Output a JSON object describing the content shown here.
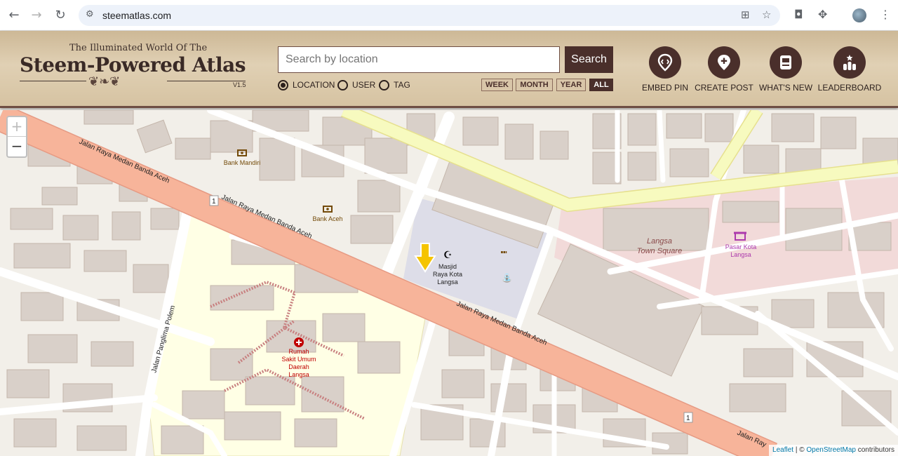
{
  "browser": {
    "url": "steematlas.com",
    "icons": [
      "back-icon",
      "forward-icon",
      "reload-icon",
      "site-info-icon",
      "translate-icon",
      "star-icon",
      "camera-icon",
      "extensions-icon",
      "profile-avatar",
      "menu-icon"
    ]
  },
  "header": {
    "subtitle": "The Illuminated World Of The",
    "title": "Steem-Powered Atlas",
    "version": "V1.5",
    "search_placeholder": "Search by location",
    "search_button": "Search",
    "modes": [
      {
        "label": "LOCATION",
        "selected": true
      },
      {
        "label": "USER",
        "selected": false
      },
      {
        "label": "TAG",
        "selected": false
      }
    ],
    "ranges": [
      {
        "label": "WEEK",
        "selected": false
      },
      {
        "label": "MONTH",
        "selected": false
      },
      {
        "label": "YEAR",
        "selected": false
      },
      {
        "label": "ALL",
        "selected": true
      }
    ],
    "actions": [
      {
        "label": "EMBED PIN",
        "icon": "pin-icon"
      },
      {
        "label": "CREATE POST",
        "icon": "add-pin-icon"
      },
      {
        "label": "WHAT'S NEW",
        "icon": "notes-icon"
      },
      {
        "label": "LEADERBOARD",
        "icon": "leaderboard-icon"
      }
    ]
  },
  "map": {
    "zoom_in": "+",
    "zoom_out": "−",
    "labels": {
      "road_main_1": "Jalan Raya Medan Banda Aceh",
      "road_main_2": "Jalan Raya Medan Banda Aceh",
      "road_main_3": "Jalan Raya Medan Banda Aceh",
      "road_main_4": "Jalan Ray",
      "road_polem": "Jalan Panglima Polem",
      "bank_mandiri": "Bank Mandiri",
      "bank_aceh": "Bank Aceh",
      "mosque_1": "Masjid",
      "mosque_2": "Raya Kota",
      "mosque_3": "Langsa",
      "town_square_1": "Langsa",
      "town_square_2": "Town Square",
      "market_1": "Pasar Kota",
      "market_2": "Langsa",
      "hospital_1": "Rumah",
      "hospital_2": "Sakit Umum",
      "hospital_3": "Daerah",
      "hospital_4": "Langsa",
      "route_shield_1": "1",
      "route_shield_2": "1"
    },
    "attribution": {
      "leaflet": "Leaflet",
      "sep": " | © ",
      "osm": "OpenStreetMap",
      "suffix": " contributors"
    },
    "colors": {
      "background": "#f2efe9",
      "building": "#d9d0c9",
      "building_stroke": "#c4b6ab",
      "primary_road": "#fcd6a4",
      "primary_road_main": "#f7b49a",
      "trunk_yellow": "#f7fabf",
      "road_white": "#ffffff",
      "hospital_area": "#ffffe5",
      "commercial_area": "#f2dad9",
      "parking": "#dddde8",
      "marker": "#f5c400"
    }
  }
}
